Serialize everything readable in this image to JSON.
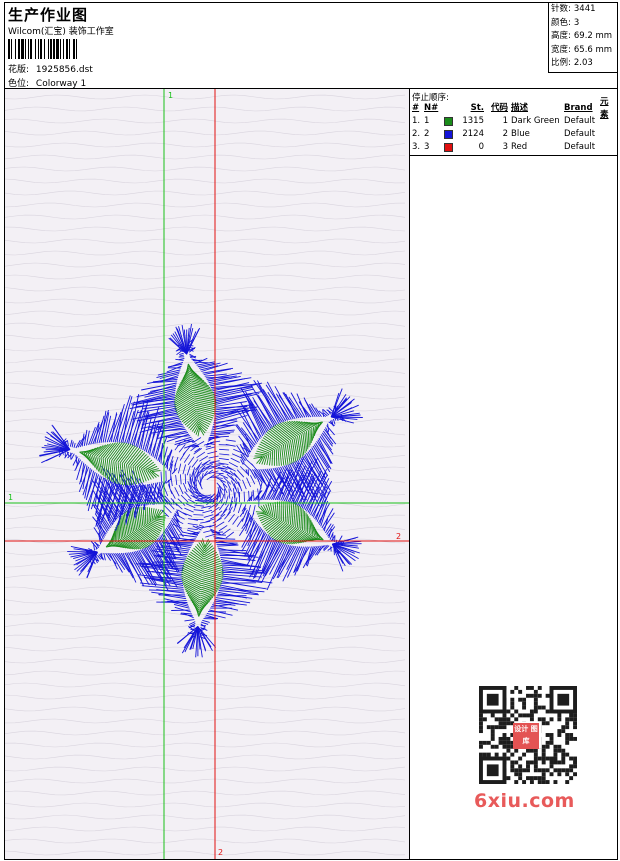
{
  "header": {
    "title": "生产作业图",
    "company": "Wilcom(汇宝) 装饰工作室",
    "design_label": "花版:",
    "design_value": "1925856.dst",
    "colorway_label": "色位:",
    "colorway_value": "Colorway 1"
  },
  "info": [
    {
      "label": "针数:",
      "value": "3441"
    },
    {
      "label": "颜色:",
      "value": "3"
    },
    {
      "label": "高度:",
      "value": "69.2 mm"
    },
    {
      "label": "宽度:",
      "value": "65.6 mm"
    },
    {
      "label": "比例:",
      "value": "2.03"
    }
  ],
  "stops": {
    "title": "停止顺序:",
    "headers": {
      "num": "#",
      "no": "N#",
      "st": "St.",
      "code": "代码",
      "desc": "描述",
      "brand": "Brand",
      "element": "元素"
    },
    "rows": [
      {
        "num": "1.",
        "no": "1",
        "color": "#1a8c1a",
        "st": "1315",
        "code": "1",
        "desc": "Dark Green",
        "brand": "Default"
      },
      {
        "num": "2.",
        "no": "2",
        "color": "#1414d8",
        "st": "2124",
        "code": "2",
        "desc": "Blue",
        "brand": "Default"
      },
      {
        "num": "3.",
        "no": "3",
        "color": "#e01010",
        "st": "0",
        "code": "3",
        "desc": "Red",
        "brand": "Default"
      }
    ]
  },
  "canvas": {
    "axis_labels": {
      "green_v": "1",
      "green_h": "1",
      "red_h": "2",
      "red_v": "2"
    },
    "colors": {
      "green": "#1a8c1a",
      "blue": "#1414d8",
      "red_line": "#e01010",
      "green_line": "#19c019"
    }
  },
  "watermark": {
    "badge": "设计 图库",
    "site": "6xiu.com"
  }
}
